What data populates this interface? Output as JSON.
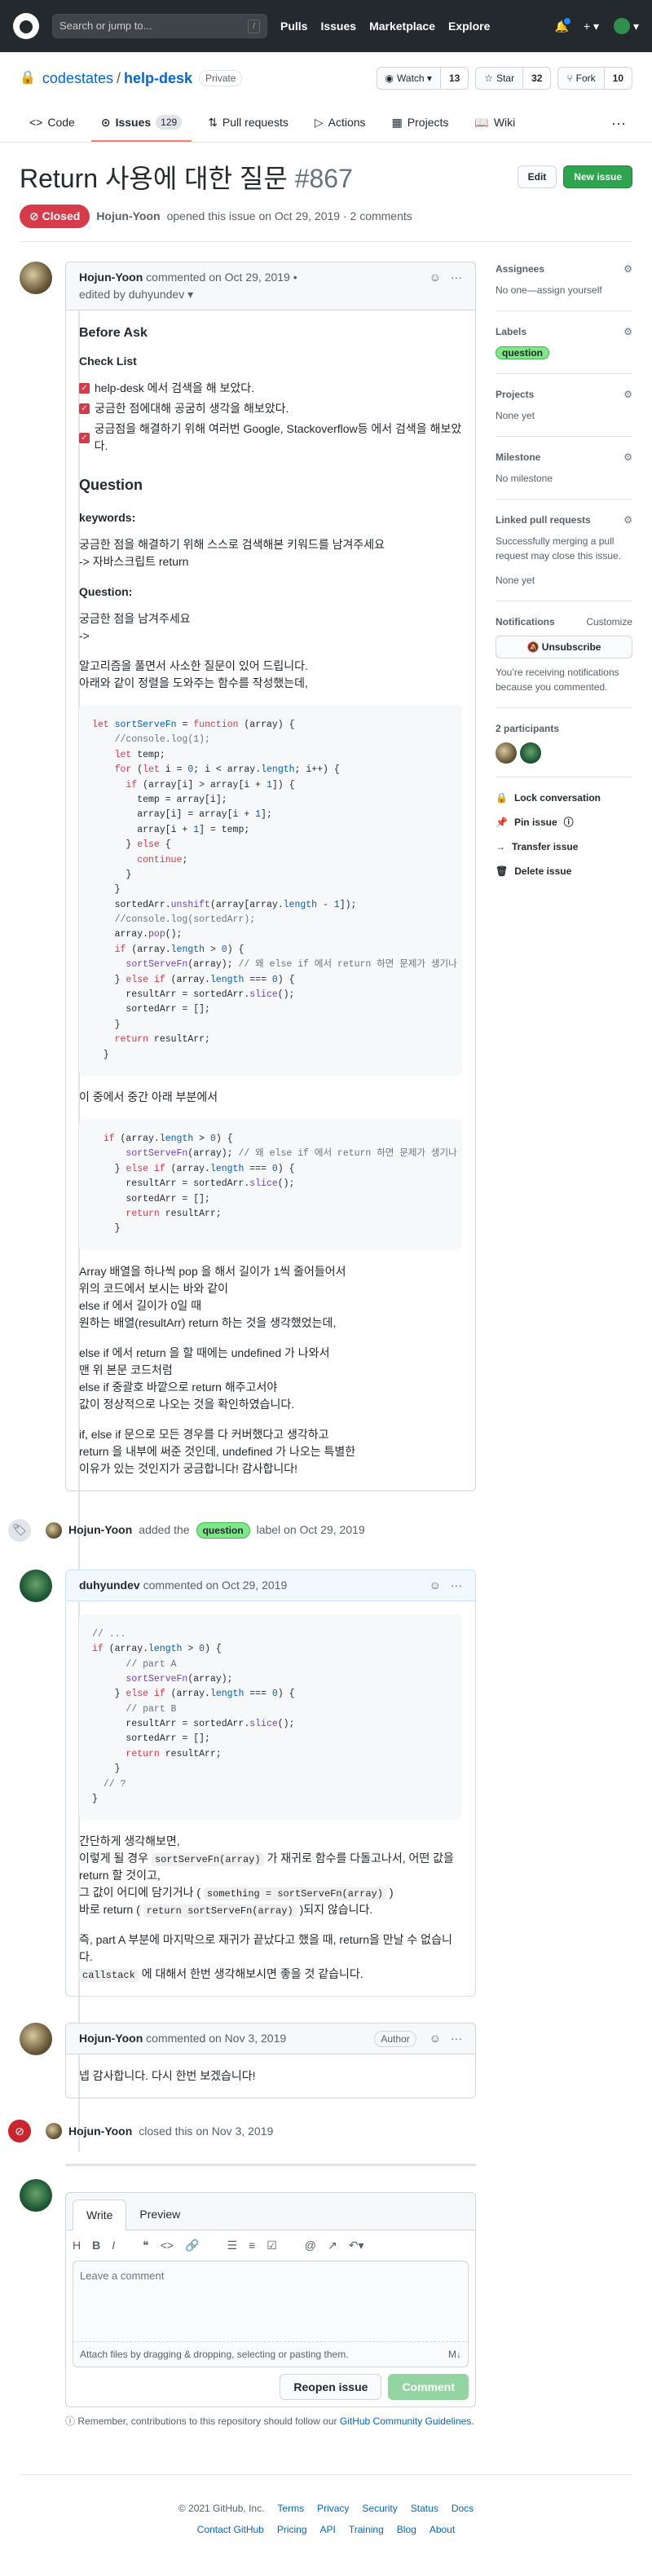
{
  "header": {
    "search_placeholder": "Search or jump to...",
    "slash": "/",
    "nav": [
      "Pulls",
      "Issues",
      "Marketplace",
      "Explore"
    ],
    "plus": "+ ▾",
    "avatar_caret": "▾"
  },
  "repo": {
    "owner": "codestates",
    "sep": "/",
    "name": "help-desk",
    "visibility": "Private",
    "watch": "Watch ▾",
    "watch_count": "13",
    "star": "Star",
    "star_count": "32",
    "fork": "Fork",
    "fork_count": "10"
  },
  "tabs": [
    {
      "label": "Code"
    },
    {
      "label": "Issues",
      "count": "129"
    },
    {
      "label": "Pull requests"
    },
    {
      "label": "Actions"
    },
    {
      "label": "Projects"
    },
    {
      "label": "Wiki"
    }
  ],
  "issue": {
    "title": "Return 사용에 대한 질문",
    "number": "#867",
    "edit": "Edit",
    "new_issue": "New issue",
    "state": "Closed",
    "author": "Hojun-Yoon",
    "meta": "opened this issue on Oct 29, 2019 · 2 comments"
  },
  "comment1": {
    "author": "Hojun-Yoon",
    "date": "commented on Oct 29, 2019 •",
    "edited": "edited by duhyundev ▾",
    "h_before": "Before Ask",
    "h_check": "Check List",
    "checks": [
      "help-desk 에서 검색을 해 보았다.",
      "궁금한 점에대해 공굼히 생각을 해보았다.",
      "궁금점을 해결하기 위해 여러번 Google, Stackoverflow등 에서 검색을 해보았다."
    ],
    "h_question": "Question",
    "h_keywords": "keywords:",
    "kw1": "궁금한 점을 해결하기 위해 스스로 검색해본 키워드를 남겨주세요",
    "kw2": "-> 자바스크립트 return",
    "h_q2": "Question:",
    "q1": "궁금한 점을 남겨주세요",
    "q2": "->",
    "p1": "알고리즘을 풀면서 사소한 질문이 있어 드립니다.",
    "p2": "아래와 같이 정렬을 도와주는 함수를 작성했는데,",
    "mid": "이 중에서 중간 아래 부분에서",
    "e1": "Array 배열을 하나씩 pop 을 해서 길이가 1씩 줄어들어서",
    "e2": "위의 코드에서 보시는 바와 같이",
    "e3": "else if 에서 길이가 0일 때",
    "e4": "원하는 배열(resultArr) return 하는 것을 생각했었는데,",
    "f1": "else if 에서 return 을 할 때에는 undefined 가 나와서",
    "f2": "맨 위 본문 코드처럼",
    "f3": "else if 중괄호 바깥으로 return 해주고서야",
    "f4": "값이 정상적으로 나오는 것을 확인하였습니다.",
    "g1": "if, else if 문으로 모든 경우를 다 커버했다고 생각하고",
    "g2": "return 을 내부에 써준 것인데, undefined 가 나오는 특별한",
    "g3": "이유가 있는 것인지가 궁금합니다! 감사합니다!"
  },
  "label_event": {
    "author": "Hojun-Yoon",
    "pre": "added the",
    "label": "question",
    "post": "label on Oct 29, 2019"
  },
  "comment2": {
    "author": "duhyundev",
    "date": "commented on Oct 29, 2019",
    "t1": "간단하게 생각해보면,",
    "t2a": "이렇게 될 경우",
    "t2code": "sortServeFn(array)",
    "t2b": "가 재귀로 함수를 다돌고나서, 어떤 값을",
    "t3": "return 할 것이고,",
    "t4a": "그 값이 어디에 담기거나 (",
    "t4code": "something = sortServeFn(array)",
    "t4b": ")",
    "t5a": "바로 return (",
    "t5code": "return sortServeFn(array)",
    "t5b": ")되지 않습니다.",
    "t6": "즉, part A 부분에 마지막으로 재귀가 끝났다고 했을 때, return을 만날 수 없습니다.",
    "t7code": "callstack",
    "t7b": "에 대해서 한번 생각해보시면 좋을 것 같습니다."
  },
  "comment3": {
    "author": "Hojun-Yoon",
    "date": "commented on Nov 3, 2019",
    "badge": "Author",
    "body": "넵 감사합니다. 다시 한번 보겠습니다!"
  },
  "close_event": {
    "author": "Hojun-Yoon",
    "text": "closed this on Nov 3, 2019"
  },
  "composer": {
    "write": "Write",
    "preview": "Preview",
    "placeholder": "Leave a comment",
    "attach": "Attach files by dragging & dropping, selecting or pasting them.",
    "reopen": "Reopen issue",
    "submit": "Comment",
    "tip": "Remember, contributions to this repository should follow our",
    "tip_link": "GitHub Community Guidelines",
    "tip_end": "."
  },
  "sidebar": {
    "assignees": "Assignees",
    "assignees_val": "No one—assign yourself",
    "labels": "Labels",
    "label_val": "question",
    "projects": "Projects",
    "projects_val": "None yet",
    "milestone": "Milestone",
    "milestone_val": "No milestone",
    "linked": "Linked pull requests",
    "linked_desc": "Successfully merging a pull request may close this issue.",
    "linked_val": "None yet",
    "notif": "Notifications",
    "customize": "Customize",
    "unsub": "Unsubscribe",
    "notif_desc": "You’re receiving notifications because you commented.",
    "participants": "2 participants",
    "actions": [
      "Lock conversation",
      "Pin issue",
      "Transfer issue",
      "Delete issue"
    ]
  },
  "footer": {
    "copyright": "© 2021 GitHub, Inc.",
    "row1": [
      "Terms",
      "Privacy",
      "Security",
      "Status",
      "Docs"
    ],
    "row2": [
      "Contact GitHub",
      "Pricing",
      "API",
      "Training",
      "Blog",
      "About"
    ]
  },
  "colors": {
    "closed": "#d73a49",
    "green": "#2ea44f",
    "header": "#24292e",
    "link": "#0366d6"
  }
}
